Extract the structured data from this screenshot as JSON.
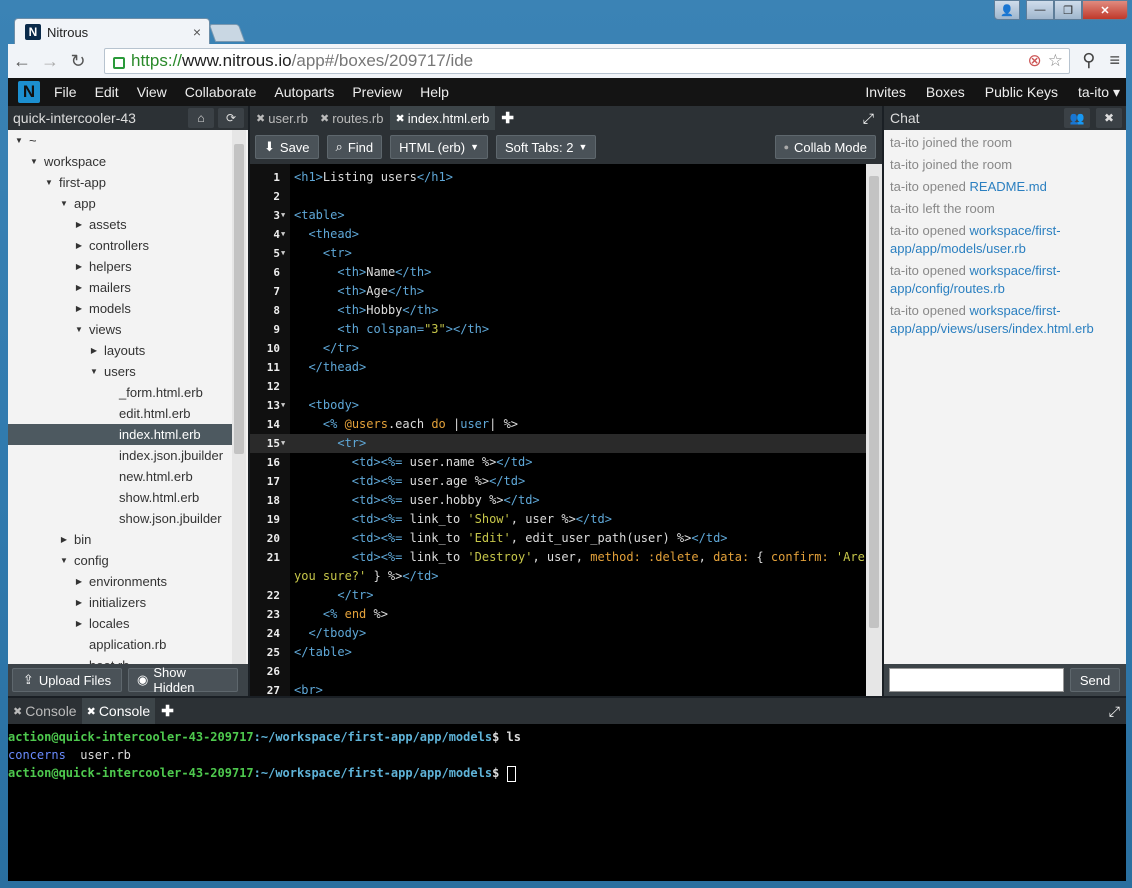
{
  "browser": {
    "tab_title": "Nitrous",
    "tab_close": "×",
    "favicon": "N",
    "url_https": "https://",
    "url_host": "www.nitrous.io",
    "url_path": "/app#/boxes/209717/ide",
    "controls": {
      "user": "👤",
      "minimize": "—",
      "maximize": "❐",
      "close": "✕"
    }
  },
  "menubar": {
    "logo": "N",
    "left": [
      "File",
      "Edit",
      "View",
      "Collaborate",
      "Autoparts",
      "Preview",
      "Help"
    ],
    "right": [
      "Invites",
      "Boxes",
      "Public Keys",
      "ta-ito ▾"
    ]
  },
  "sidebar": {
    "box_name": "quick-intercooler-43",
    "tree": [
      {
        "label": "~",
        "depth": 0,
        "state": "open"
      },
      {
        "label": "workspace",
        "depth": 1,
        "state": "open"
      },
      {
        "label": "first-app",
        "depth": 2,
        "state": "open"
      },
      {
        "label": "app",
        "depth": 3,
        "state": "open"
      },
      {
        "label": "assets",
        "depth": 4,
        "state": "closed"
      },
      {
        "label": "controllers",
        "depth": 4,
        "state": "closed"
      },
      {
        "label": "helpers",
        "depth": 4,
        "state": "closed"
      },
      {
        "label": "mailers",
        "depth": 4,
        "state": "closed"
      },
      {
        "label": "models",
        "depth": 4,
        "state": "closed"
      },
      {
        "label": "views",
        "depth": 4,
        "state": "open"
      },
      {
        "label": "layouts",
        "depth": 5,
        "state": "closed"
      },
      {
        "label": "users",
        "depth": 5,
        "state": "open"
      },
      {
        "label": "_form.html.erb",
        "depth": 6,
        "state": "file"
      },
      {
        "label": "edit.html.erb",
        "depth": 6,
        "state": "file"
      },
      {
        "label": "index.html.erb",
        "depth": 6,
        "state": "file",
        "selected": true
      },
      {
        "label": "index.json.jbuilder",
        "depth": 6,
        "state": "file"
      },
      {
        "label": "new.html.erb",
        "depth": 6,
        "state": "file"
      },
      {
        "label": "show.html.erb",
        "depth": 6,
        "state": "file"
      },
      {
        "label": "show.json.jbuilder",
        "depth": 6,
        "state": "file"
      },
      {
        "label": "bin",
        "depth": 3,
        "state": "closed"
      },
      {
        "label": "config",
        "depth": 3,
        "state": "open"
      },
      {
        "label": "environments",
        "depth": 4,
        "state": "closed"
      },
      {
        "label": "initializers",
        "depth": 4,
        "state": "closed"
      },
      {
        "label": "locales",
        "depth": 4,
        "state": "closed"
      },
      {
        "label": "application.rb",
        "depth": 4,
        "state": "file"
      },
      {
        "label": "boot.rb",
        "depth": 4,
        "state": "file"
      }
    ],
    "upload_label": "Upload Files",
    "hidden_label": "Show Hidden"
  },
  "editor": {
    "tabs": [
      {
        "label": "user.rb",
        "active": false
      },
      {
        "label": "routes.rb",
        "active": false
      },
      {
        "label": "index.html.erb",
        "active": true
      }
    ],
    "save_label": "Save",
    "find_label": "Find",
    "mode_label": "HTML (erb)",
    "tabs_label": "Soft Tabs: 2",
    "collab_label": "Collab Mode",
    "active_line": 15,
    "lines": [
      {
        "n": "1",
        "fold": false,
        "segs": [
          [
            "tag",
            "<h1>"
          ],
          [
            "t",
            "Listing users"
          ],
          [
            "tag",
            "</h1>"
          ]
        ]
      },
      {
        "n": "2",
        "fold": false,
        "segs": []
      },
      {
        "n": "3",
        "fold": true,
        "segs": [
          [
            "tag",
            "<table>"
          ]
        ]
      },
      {
        "n": "4",
        "fold": true,
        "segs": [
          [
            "t",
            "  "
          ],
          [
            "tag",
            "<thead>"
          ]
        ]
      },
      {
        "n": "5",
        "fold": true,
        "segs": [
          [
            "t",
            "    "
          ],
          [
            "tag",
            "<tr>"
          ]
        ]
      },
      {
        "n": "6",
        "fold": false,
        "segs": [
          [
            "t",
            "      "
          ],
          [
            "tag",
            "<th>"
          ],
          [
            "t",
            "Name"
          ],
          [
            "tag",
            "</th>"
          ]
        ]
      },
      {
        "n": "7",
        "fold": false,
        "segs": [
          [
            "t",
            "      "
          ],
          [
            "tag",
            "<th>"
          ],
          [
            "t",
            "Age"
          ],
          [
            "tag",
            "</th>"
          ]
        ]
      },
      {
        "n": "8",
        "fold": false,
        "segs": [
          [
            "t",
            "      "
          ],
          [
            "tag",
            "<th>"
          ],
          [
            "t",
            "Hobby"
          ],
          [
            "tag",
            "</th>"
          ]
        ]
      },
      {
        "n": "9",
        "fold": false,
        "segs": [
          [
            "t",
            "      "
          ],
          [
            "tag",
            "<th colspan="
          ],
          [
            "str",
            "\"3\""
          ],
          [
            "tag",
            "></th>"
          ]
        ]
      },
      {
        "n": "10",
        "fold": false,
        "segs": [
          [
            "t",
            "    "
          ],
          [
            "tag",
            "</tr>"
          ]
        ]
      },
      {
        "n": "11",
        "fold": false,
        "segs": [
          [
            "t",
            "  "
          ],
          [
            "tag",
            "</thead>"
          ]
        ]
      },
      {
        "n": "12",
        "fold": false,
        "segs": []
      },
      {
        "n": "13",
        "fold": true,
        "segs": [
          [
            "t",
            "  "
          ],
          [
            "tag",
            "<tbody>"
          ]
        ]
      },
      {
        "n": "14",
        "fold": false,
        "segs": [
          [
            "t",
            "    "
          ],
          [
            "tag",
            "<%"
          ],
          [
            "t",
            " "
          ],
          [
            "var",
            "@users"
          ],
          [
            "t",
            ".each "
          ],
          [
            "kw",
            "do"
          ],
          [
            "t",
            " |"
          ],
          [
            "tag",
            "user"
          ],
          [
            "t",
            "| %>"
          ]
        ]
      },
      {
        "n": "15",
        "fold": true,
        "segs": [
          [
            "t",
            "      "
          ],
          [
            "tag",
            "<tr>"
          ]
        ]
      },
      {
        "n": "16",
        "fold": false,
        "segs": [
          [
            "t",
            "        "
          ],
          [
            "tag",
            "<td><%="
          ],
          [
            "t",
            " user.name %>"
          ],
          [
            "tag",
            "</td>"
          ]
        ]
      },
      {
        "n": "17",
        "fold": false,
        "segs": [
          [
            "t",
            "        "
          ],
          [
            "tag",
            "<td><%="
          ],
          [
            "t",
            " user.age %>"
          ],
          [
            "tag",
            "</td>"
          ]
        ]
      },
      {
        "n": "18",
        "fold": false,
        "segs": [
          [
            "t",
            "        "
          ],
          [
            "tag",
            "<td><%="
          ],
          [
            "t",
            " user.hobby %>"
          ],
          [
            "tag",
            "</td>"
          ]
        ]
      },
      {
        "n": "19",
        "fold": false,
        "segs": [
          [
            "t",
            "        "
          ],
          [
            "tag",
            "<td><%="
          ],
          [
            "t",
            " link_to "
          ],
          [
            "str",
            "'Show'"
          ],
          [
            "t",
            ", user %>"
          ],
          [
            "tag",
            "</td>"
          ]
        ]
      },
      {
        "n": "20",
        "fold": false,
        "segs": [
          [
            "t",
            "        "
          ],
          [
            "tag",
            "<td><%="
          ],
          [
            "t",
            " link_to "
          ],
          [
            "str",
            "'Edit'"
          ],
          [
            "t",
            ", edit_user_path(user) %>"
          ],
          [
            "tag",
            "</td>"
          ]
        ]
      },
      {
        "n": "21",
        "fold": false,
        "segs": [
          [
            "t",
            "        "
          ],
          [
            "tag",
            "<td><%="
          ],
          [
            "t",
            " link_to "
          ],
          [
            "str",
            "'Destroy'"
          ],
          [
            "t",
            ", user, "
          ],
          [
            "kw",
            "method:"
          ],
          [
            "t",
            " "
          ],
          [
            "kw",
            ":delete"
          ],
          [
            "t",
            ", "
          ],
          [
            "kw",
            "data:"
          ],
          [
            "t",
            " { "
          ],
          [
            "kw",
            "confirm:"
          ],
          [
            "t",
            " "
          ],
          [
            "str",
            "'Are"
          ]
        ]
      },
      {
        "n": "",
        "fold": false,
        "wrap": true,
        "segs": [
          [
            "str",
            "you sure?'"
          ],
          [
            "t",
            " } %>"
          ],
          [
            "tag",
            "</td>"
          ]
        ]
      },
      {
        "n": "22",
        "fold": false,
        "segs": [
          [
            "t",
            "      "
          ],
          [
            "tag",
            "</tr>"
          ]
        ]
      },
      {
        "n": "23",
        "fold": false,
        "segs": [
          [
            "t",
            "    "
          ],
          [
            "tag",
            "<%"
          ],
          [
            "t",
            " "
          ],
          [
            "kw",
            "end"
          ],
          [
            "t",
            " %>"
          ]
        ]
      },
      {
        "n": "24",
        "fold": false,
        "segs": [
          [
            "t",
            "  "
          ],
          [
            "tag",
            "</tbody>"
          ]
        ]
      },
      {
        "n": "25",
        "fold": false,
        "segs": [
          [
            "tag",
            "</table>"
          ]
        ]
      },
      {
        "n": "26",
        "fold": false,
        "segs": []
      },
      {
        "n": "27",
        "fold": false,
        "segs": [
          [
            "tag",
            "<br>"
          ]
        ]
      }
    ]
  },
  "chat": {
    "title": "Chat",
    "messages": [
      {
        "text": "ta-ito joined the room",
        "link": ""
      },
      {
        "text": "ta-ito joined the room",
        "link": ""
      },
      {
        "text": "ta-ito opened ",
        "link": "README.md"
      },
      {
        "text": "ta-ito left the room",
        "link": ""
      },
      {
        "text": "ta-ito opened ",
        "link": "workspace/first-app/app/models/user.rb"
      },
      {
        "text": "ta-ito opened ",
        "link": "workspace/first-app/config/routes.rb"
      },
      {
        "text": "ta-ito opened ",
        "link": "workspace/first-app/app/views/users/index.html.erb"
      }
    ],
    "input_placeholder": "",
    "send_label": "Send"
  },
  "console": {
    "tabs": [
      {
        "label": "Console",
        "active": false
      },
      {
        "label": "Console",
        "active": true
      }
    ],
    "prompt_user": "action@quick-intercooler-43-209717",
    "prompt_path": ":~/workspace/first-app/app/models",
    "prompt_end": "$ ",
    "command": "ls",
    "ls_dir": "concerns",
    "ls_file": "user.rb"
  },
  "colors": {
    "accent": "#1c8fd0",
    "tag": "#5fa8d8",
    "keyword": "#e3a13a",
    "string": "#c7c74a",
    "prompt": "#4ec94e"
  }
}
